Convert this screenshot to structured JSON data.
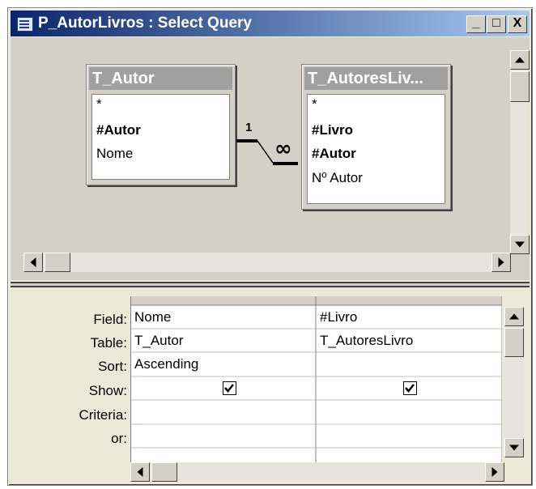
{
  "window": {
    "title": "P_AutorLivros : Select Query",
    "controls": [
      "_",
      "□",
      "X"
    ]
  },
  "tables": [
    {
      "name": "T_Autor",
      "fields": [
        {
          "label": "*",
          "key": false
        },
        {
          "label": "#Autor",
          "key": true
        },
        {
          "label": "Nome",
          "key": false
        }
      ]
    },
    {
      "name": "T_AutoresLiv...",
      "fields": [
        {
          "label": "*",
          "key": false
        },
        {
          "label": "#Livro",
          "key": true
        },
        {
          "label": "#Autor",
          "key": true
        },
        {
          "label": "Nº Autor",
          "key": false
        }
      ]
    }
  ],
  "relationship": {
    "one_label": "1",
    "many_label": "∞"
  },
  "grid": {
    "row_labels": [
      "Field:",
      "Table:",
      "Sort:",
      "Show:",
      "Criteria:",
      "or:"
    ],
    "columns": [
      {
        "field": "Nome",
        "table": "T_Autor",
        "sort": "Ascending",
        "show": true,
        "criteria": "",
        "or": ""
      },
      {
        "field": "#Livro",
        "table": "T_AutoresLivro",
        "sort": "",
        "show": true,
        "criteria": "",
        "or": ""
      }
    ]
  },
  "icons": {
    "title": "query-icon",
    "check": "checkmark-icon"
  }
}
